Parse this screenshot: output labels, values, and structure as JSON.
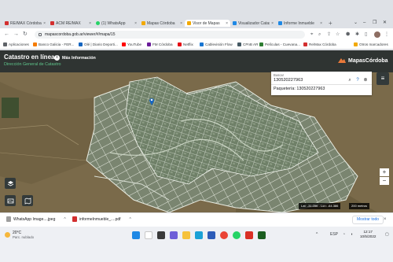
{
  "browser": {
    "tabs": [
      {
        "title": "RE/MAX Córdoba",
        "favicon_color": "#d32f2f",
        "active": false
      },
      {
        "title": "ACM RE/MAX",
        "favicon_color": "#d32f2f",
        "active": false
      },
      {
        "title": "(1) WhatsApp",
        "favicon_color": "#25d366",
        "active": false
      },
      {
        "title": "Mapas Córdoba",
        "favicon_color": "#f2a900",
        "active": false
      },
      {
        "title": "Visor de Mapas",
        "favicon_color": "#f2a900",
        "active": true
      },
      {
        "title": "Visualizador Catas",
        "favicon_color": "#1e88e5",
        "active": false
      },
      {
        "title": "Informe Inmueble",
        "favicon_color": "#1e88e5",
        "active": false
      }
    ],
    "new_tab": "+",
    "url": "mapascordoba.gob.ar/viewer/#/mapa/15",
    "bookmarks": [
      {
        "label": "Aplicaciones",
        "color": "#5f6368"
      },
      {
        "label": "Banco Galicia - FER...",
        "color": "#f57c00"
      },
      {
        "label": "Olé | Diario Deporti...",
        "color": "#1565c0"
      },
      {
        "label": "YouTube",
        "color": "#ff0000"
      },
      {
        "label": "FM Córdoba",
        "color": "#6a1b9a"
      },
      {
        "label": "Netflix",
        "color": "#e50914"
      },
      {
        "label": "Cablevisión Flow",
        "color": "#1976d2"
      },
      {
        "label": "CPnB AR",
        "color": "#455a64"
      },
      {
        "label": "Películas - Cuevana...",
        "color": "#2e7d32"
      },
      {
        "label": "Re/Max Córdoba",
        "color": "#d32f2f"
      },
      {
        "label": "Otros marcadores",
        "color": "#f2a900"
      }
    ]
  },
  "app": {
    "title": "Catastro en línea",
    "subtitle": "Dirección General de Catastro",
    "info_label": "Más Información",
    "brand": "MapasCórdoba",
    "search_label": "Buscar",
    "search_value": "130520227963",
    "suggestion": "Paquetería: 130520227963",
    "menu_icon": "hamburger-icon",
    "zoom_in": "+",
    "zoom_out": "−",
    "coords": "Lat: -31.056 - Lon: -64.386",
    "scale": "200 metros"
  },
  "downloads": [
    {
      "name": "WhatsApp Image....jpeg",
      "color": "#9e9e9e"
    },
    {
      "name": "informeInmueble_....pdf",
      "color": "#d32f2f"
    }
  ],
  "downloads_show_all": "Mostrar todo",
  "taskbar": {
    "weather_temp": "20°C",
    "weather_desc": "Parc. nublado",
    "language": "ESP",
    "time": "12:17",
    "date": "10/5/2022"
  }
}
